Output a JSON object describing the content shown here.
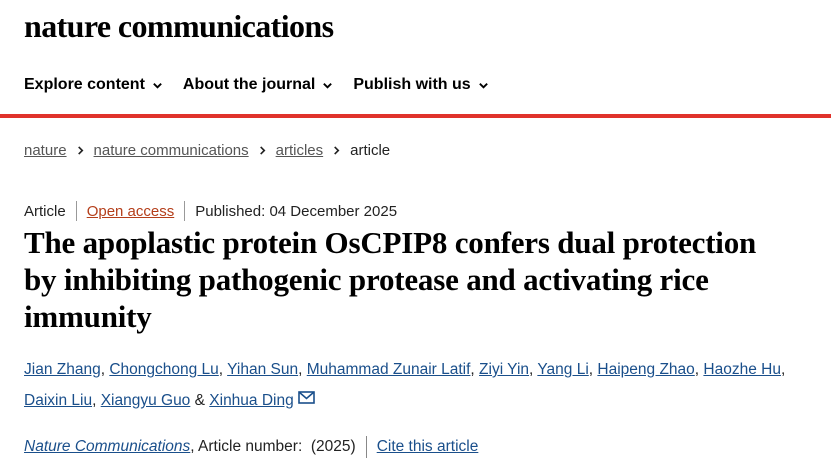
{
  "header": {
    "logo": "nature communications"
  },
  "nav": {
    "items": [
      {
        "label": "Explore content"
      },
      {
        "label": "About the journal"
      },
      {
        "label": "Publish with us"
      }
    ]
  },
  "breadcrumb": {
    "items": [
      "nature",
      "nature communications",
      "articles"
    ],
    "current": "article"
  },
  "article_meta": {
    "type": "Article",
    "access": "Open access",
    "published": "Published: 04 December 2025"
  },
  "title": "The apoplastic protein OsCPIP8 confers dual protection by inhibiting pathogenic protease and activating rice immunity",
  "authors": [
    "Jian Zhang",
    "Chongchong Lu",
    "Yihan Sun",
    "Muhammad Zunair Latif",
    "Ziyi Yin",
    "Yang Li",
    "Haipeng Zhao",
    "Haozhe Hu",
    "Daixin Liu",
    "Xiangyu Guo",
    "Xinhua Ding"
  ],
  "authors_conjunction": "&",
  "citation": {
    "journal": "Nature Communications",
    "article_number": ", Article number:  (2025)",
    "cite_link": "Cite this article"
  },
  "colors": {
    "accent_red": "#e0322b",
    "link_blue": "#1a4f8b",
    "open_access": "#b43e1a"
  }
}
